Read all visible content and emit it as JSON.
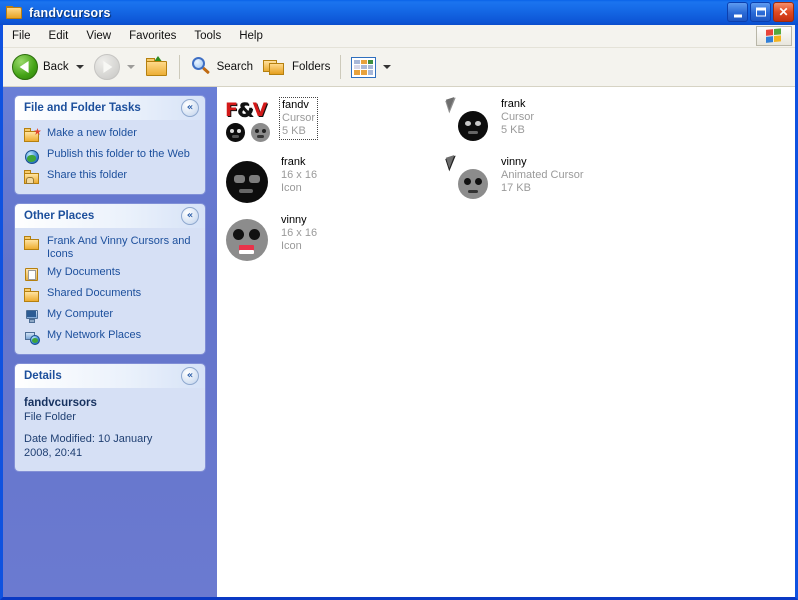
{
  "window": {
    "title": "fandvcursors",
    "folder_icon": "folder-icon",
    "controls": {
      "minimize": "minimize-button",
      "maximize": "maximize-button",
      "close_glyph": "✕"
    }
  },
  "menu": {
    "items": [
      "File",
      "Edit",
      "View",
      "Favorites",
      "Tools",
      "Help"
    ],
    "logo": "windows-flag-icon"
  },
  "toolbar": {
    "back_label": "Back",
    "forward_label": "",
    "search_label": "Search",
    "folders_label": "Folders",
    "views_label": "",
    "icons": {
      "back": "back-arrow-icon",
      "forward": "forward-arrow-icon",
      "up": "up-folder-icon",
      "search": "magnifier-icon",
      "folders": "folders-icon",
      "views": "views-grid-icon"
    }
  },
  "sidebar": {
    "panels": [
      {
        "title": "File and Folder Tasks",
        "collapse_glyph": "«",
        "tasks": [
          {
            "label": "Make a new folder",
            "icon": "new-folder-icon"
          },
          {
            "label": "Publish this folder to the Web",
            "icon": "globe-icon"
          },
          {
            "label": "Share this folder",
            "icon": "share-folder-icon"
          }
        ]
      },
      {
        "title": "Other Places",
        "collapse_glyph": "«",
        "tasks": [
          {
            "label": "Frank And Vinny Cursors and Icons",
            "icon": "folder-icon"
          },
          {
            "label": "My Documents",
            "icon": "my-documents-icon"
          },
          {
            "label": "Shared Documents",
            "icon": "folder-icon"
          },
          {
            "label": "My Computer",
            "icon": "my-computer-icon"
          },
          {
            "label": "My Network Places",
            "icon": "network-icon"
          }
        ]
      }
    ],
    "details": {
      "title": "Details",
      "collapse_glyph": "«",
      "name": "fandvcursors",
      "type": "File Folder",
      "modified_line1": "Date Modified: 10 January",
      "modified_line2": "2008, 20:41"
    }
  },
  "files": [
    {
      "name": "fandv",
      "type": "Cursor",
      "size": "5 KB",
      "icon": "fandv-thumbnail",
      "selected": true,
      "logo_text_1": "F",
      "logo_text_2": "&",
      "logo_text_3": "V"
    },
    {
      "name": "frank",
      "type": "Cursor",
      "size": "5 KB",
      "icon": "frank-cursor-icon",
      "selected": false
    },
    {
      "name": "frank",
      "type": "16 x 16",
      "size": "Icon",
      "icon": "frank-face-icon",
      "selected": false
    },
    {
      "name": "vinny",
      "type": "Animated Cursor",
      "size": "17 KB",
      "icon": "vinny-cursor-icon",
      "selected": false
    },
    {
      "name": "vinny",
      "type": "16 x 16",
      "size": "Icon",
      "icon": "vinny-face-icon",
      "selected": false
    }
  ],
  "colors": {
    "titlebar_blue": "#1569e6",
    "sidebar_blue": "#6374cb",
    "panel_body": "#d6e0f5",
    "link_blue": "#1c4f9c",
    "meta_grey": "#9a9a9a",
    "close_red": "#e04a22"
  }
}
